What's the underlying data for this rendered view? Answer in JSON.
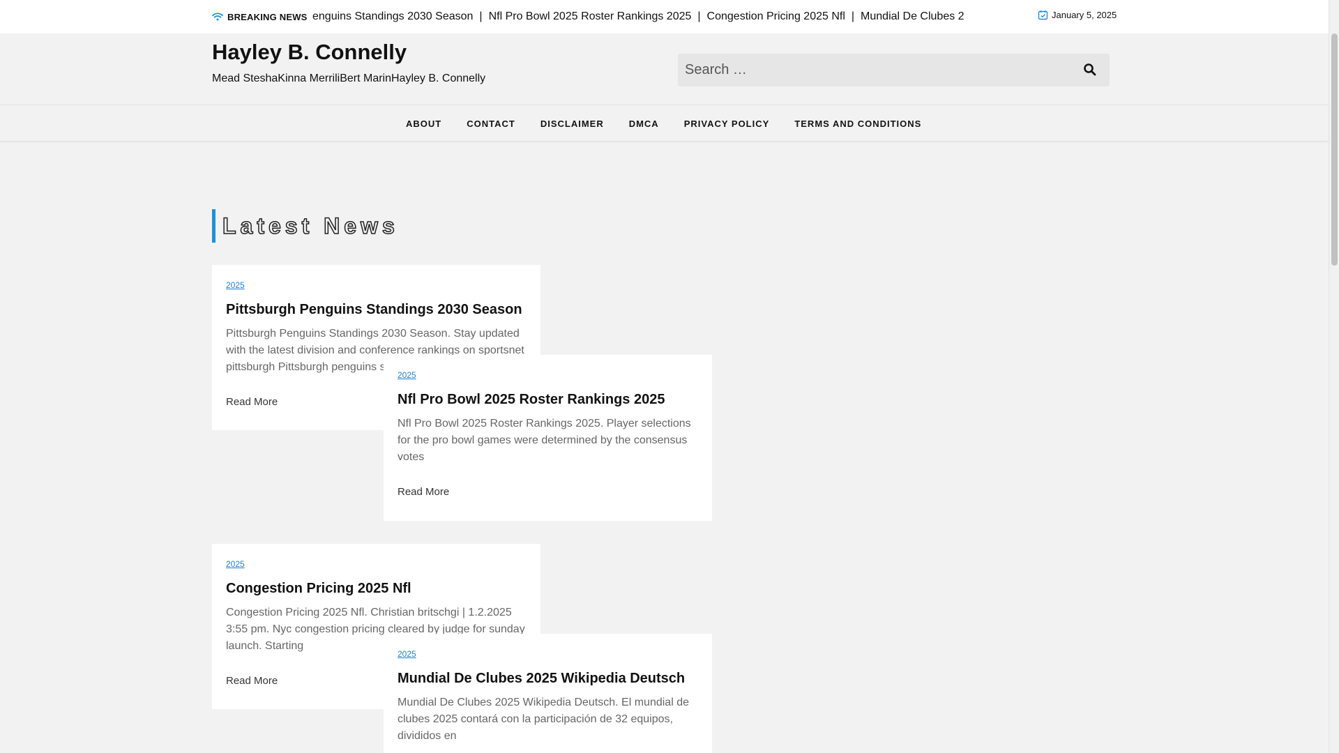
{
  "breaking": {
    "label": "BREAKING NEWS",
    "items": [
      "enguins Standings 2030 Season",
      "Nfl Pro Bowl 2025 Roster Rankings 2025",
      "Congestion Pricing 2025 Nfl",
      "Mundial De Clubes 2"
    ],
    "separator": "|"
  },
  "date": "January 5, 2025",
  "site": {
    "title": "Hayley B. Connelly",
    "tagline": "Mead SteshaKinna MerriliBert MarinHayley B. Connelly"
  },
  "search": {
    "placeholder": "Search …"
  },
  "nav": [
    "ABOUT",
    "CONTACT",
    "DISCLAIMER",
    "DMCA",
    "PRIVACY POLICY",
    "TERMS AND CONDITIONS"
  ],
  "section_title": "Latest News",
  "posts": [
    {
      "category": "2025",
      "title": "Pittsburgh Penguins Standings 2030 Season",
      "excerpt": "Pittsburgh Penguins Standings 2030 Season. Stay updated with the latest division and conference rankings on sportsnet pittsburgh Pittsburgh penguins s",
      "read_more": "Read More"
    },
    {
      "category": "2025",
      "title": "Nfl Pro Bowl 2025 Roster Rankings 2025",
      "excerpt": "Nfl Pro Bowl 2025 Roster Rankings 2025. Player selections for the pro bowl games were determined by the consensus votes",
      "read_more": "Read More"
    },
    {
      "category": "2025",
      "title": "Congestion Pricing 2025 Nfl",
      "excerpt": "Congestion Pricing 2025 Nfl. Christian britschgi | 1.2.2025 3:55 pm. Nyc congestion pricing cleared by judge for sunday launch. Starting",
      "read_more": "Read More"
    },
    {
      "category": "2025",
      "title": "Mundial De Clubes 2025 Wikipedia Deutsch",
      "excerpt": "Mundial De Clubes 2025 Wikipedia Deutsch. El mundial de clubes 2025 contará con la participación de 32 equipos, divididos en",
      "read_more": ""
    }
  ],
  "colors": {
    "accent": "#1e90d6",
    "background": "#f2f2f2",
    "card": "#ffffff",
    "link": "#1e7fd0"
  },
  "icons": {
    "breaking": "wifi-icon",
    "date": "calendar-check-icon",
    "search": "search-icon"
  }
}
